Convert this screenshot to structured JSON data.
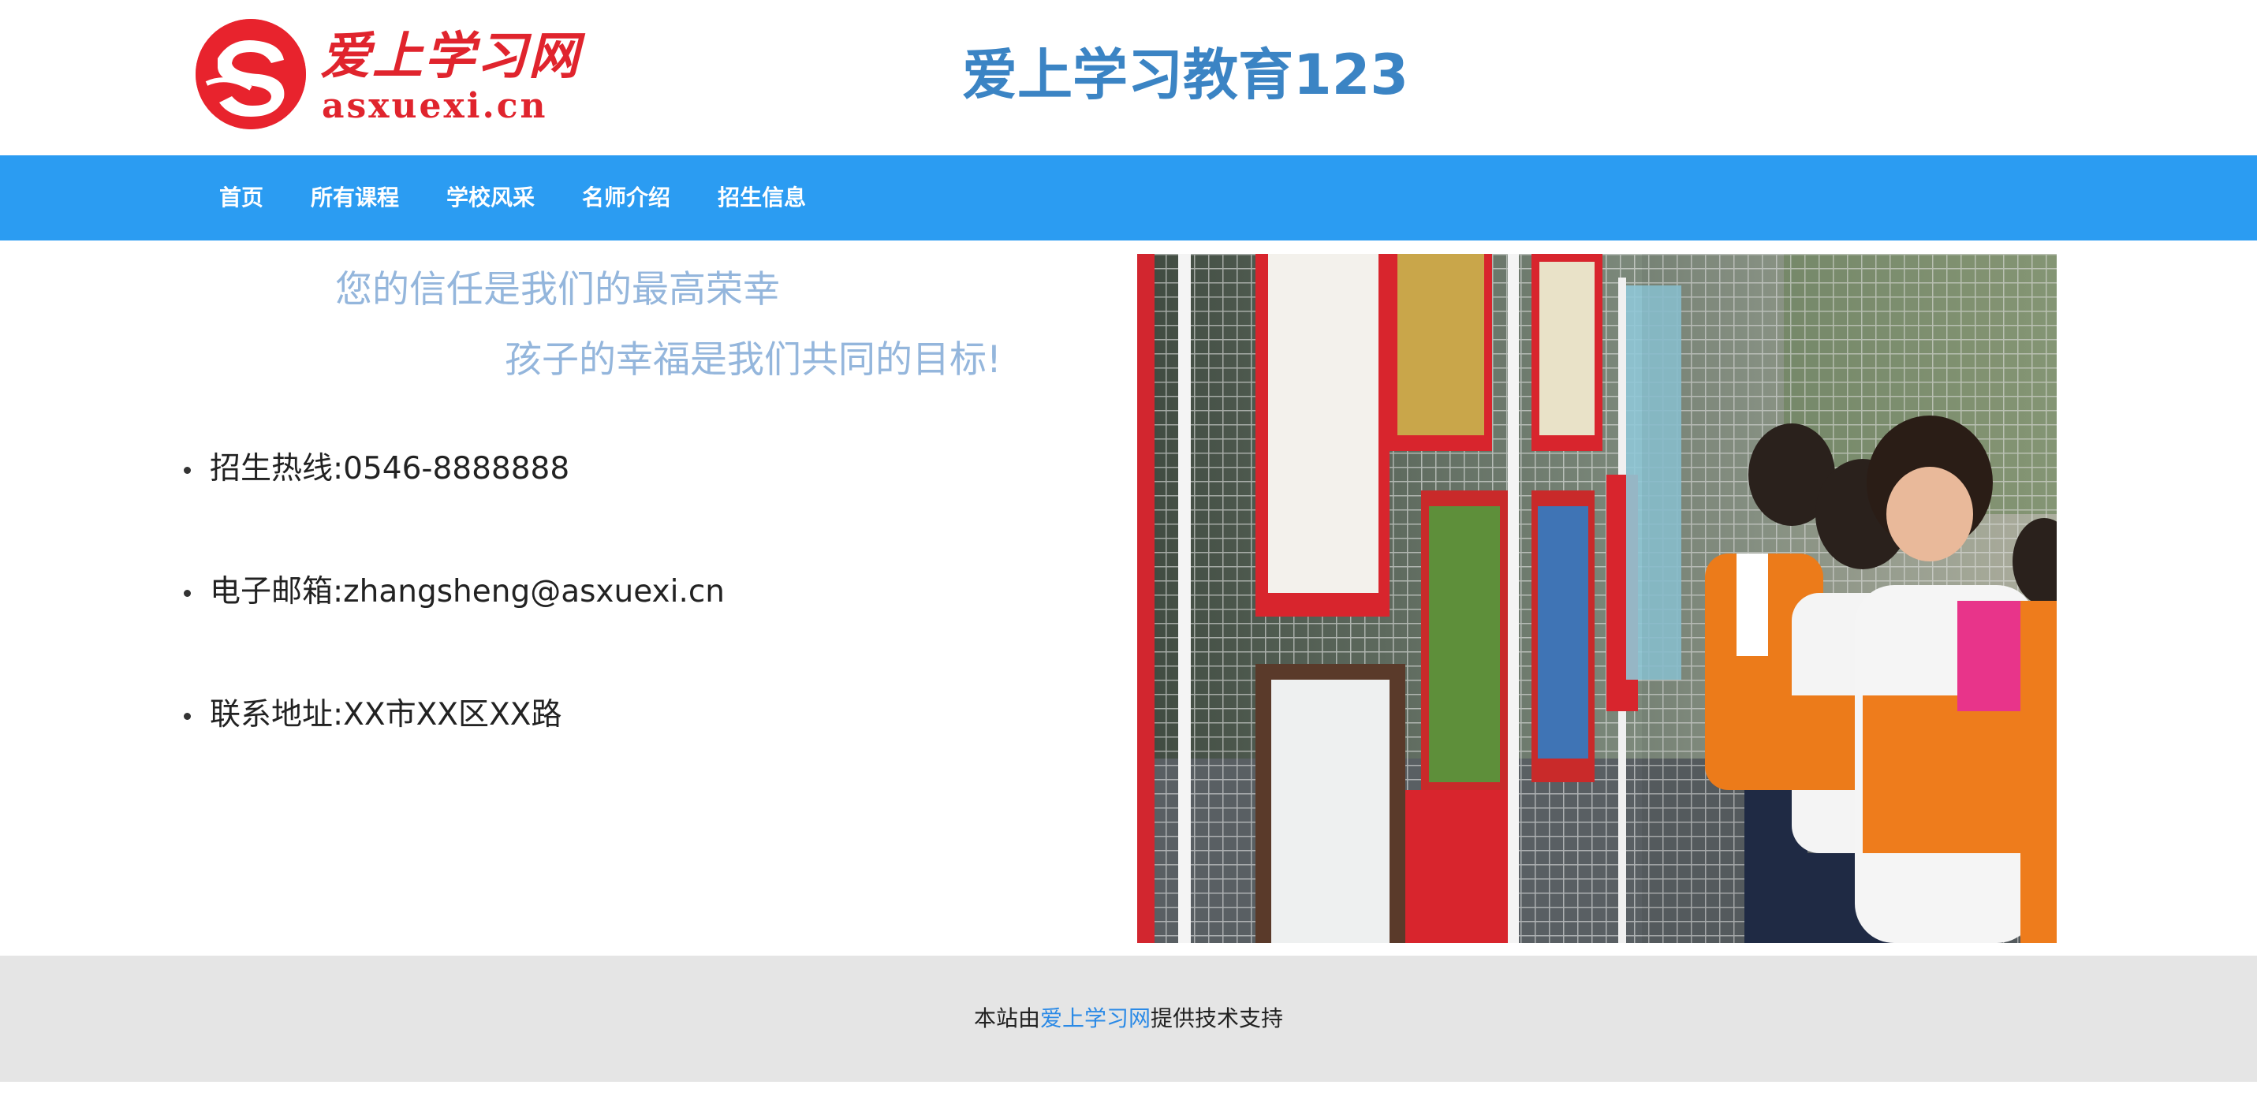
{
  "header": {
    "logo": {
      "name_cn": "爱上学习网",
      "domain": "asxuexi.cn",
      "icon": "logo-emblem-icon"
    },
    "site_title": "爱上学习教育123"
  },
  "nav": {
    "items": [
      {
        "label": "首页"
      },
      {
        "label": "所有课程"
      },
      {
        "label": "学校风采"
      },
      {
        "label": "名师介绍"
      },
      {
        "label": "招生信息"
      }
    ]
  },
  "main": {
    "slogan_line1": "您的信任是我们的最高荣幸",
    "slogan_line2": "孩子的幸福是我们共同的目标!",
    "contacts": [
      {
        "text": "招生热线:0546-8888888"
      },
      {
        "text": "电子邮箱:zhangsheng@asxuexi.cn"
      },
      {
        "text": "联系地址:XX市XX区XX路"
      }
    ],
    "photo": {
      "icon": "students-art-exhibition-photo"
    }
  },
  "footer": {
    "prefix": "本站由",
    "link": "爱上学习网",
    "suffix": "提供技术支持"
  },
  "colors": {
    "nav_bg": "#2b9cf2",
    "title": "#3b84c4",
    "slogan": "#94b6dc",
    "logo_red": "#e0242d",
    "footer_bg": "#e5e5e5",
    "link": "#2b8ae6"
  }
}
